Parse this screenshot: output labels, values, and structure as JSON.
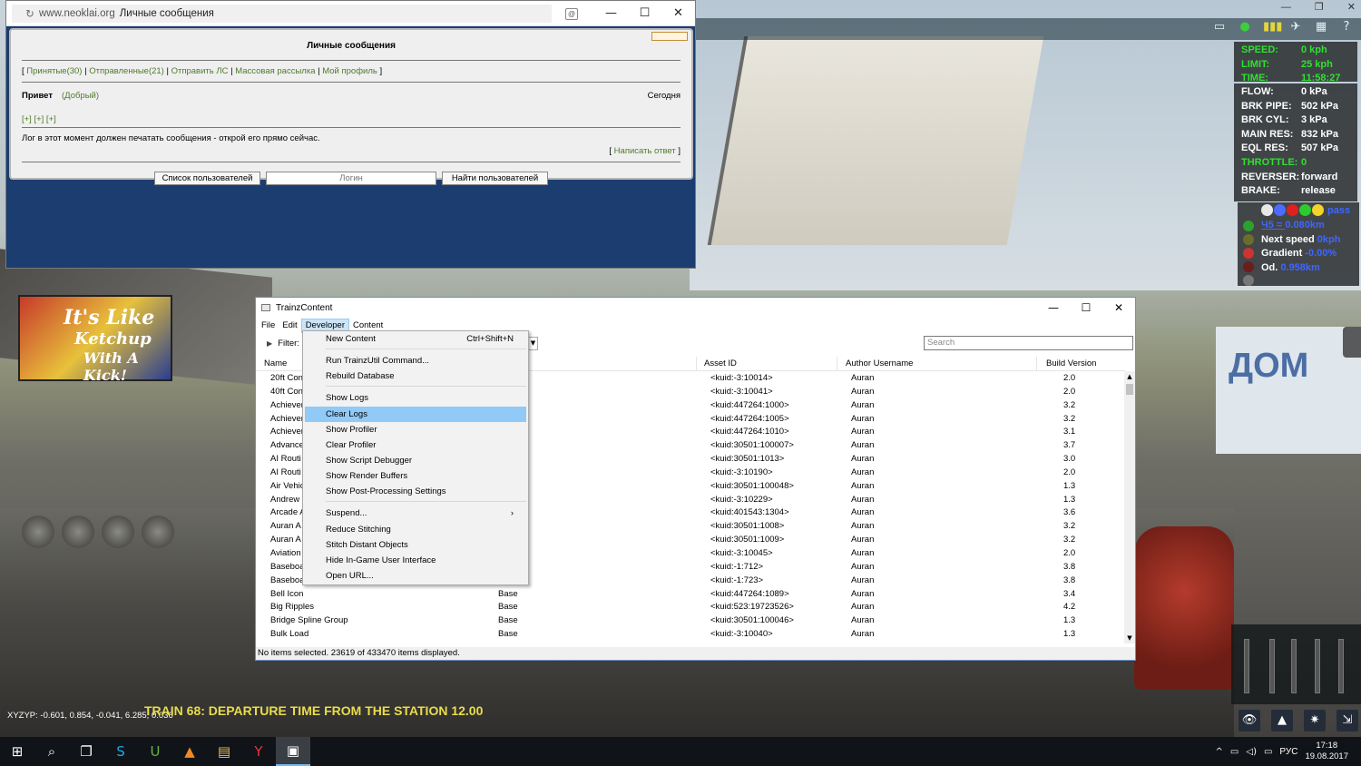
{
  "game_window": {
    "controls": [
      "—",
      "❐",
      "✕"
    ],
    "hud_icons": [
      "▭",
      "●",
      "▮▮▮",
      "✈",
      "▦",
      "?"
    ]
  },
  "hud": {
    "speed": [
      {
        "label": "SPEED:",
        "value": "0 kph"
      },
      {
        "label": "LIMIT:",
        "value": "25 kph"
      },
      {
        "label": "TIME:",
        "value": "11:58:27"
      }
    ],
    "air": [
      {
        "label": "FLOW:",
        "value": "0 kPa",
        "green": false
      },
      {
        "label": "BRK PIPE:",
        "value": "502 kPa",
        "green": false
      },
      {
        "label": "BRK CYL:",
        "value": "3 kPa",
        "green": false
      },
      {
        "label": "MAIN RES:",
        "value": "832 kPa",
        "green": false
      },
      {
        "label": "EQL RES:",
        "value": "507 kPa",
        "green": false
      },
      {
        "label": "THROTTLE:",
        "value": "0",
        "green": true
      },
      {
        "label": "REVERSER:",
        "value": "forward",
        "green": false
      },
      {
        "label": "BRAKE:",
        "value": "release",
        "green": false
      }
    ],
    "signal": {
      "pass_label": "pass",
      "lamp_colors": [
        "#e8e8e8",
        "#4b6cff",
        "#e02020",
        "#2bcc2b",
        "#f2d22b"
      ],
      "distance_label": "Ч5 = ",
      "distance_value": "0.080km",
      "next_speed_label": "Next speed ",
      "next_speed_value": "0kph",
      "gradient_label": "Gradient ",
      "gradient_value": "-0.00%",
      "od_label": "Od. ",
      "od_value": "0.958km"
    },
    "bottom_buttons": [
      "👁",
      "▲",
      "✷",
      "⇲"
    ]
  },
  "overlay": {
    "coords": "XYZYP: -0.601, 0.854, -0.041, 6.285, 0.036",
    "train_message": "TRAIN 68: DEPARTURE TIME FROM THE STATION 12.00"
  },
  "browser": {
    "address_domain": "www.neoklai.org",
    "address_title": "Личные сообщения",
    "controls": [
      "—",
      "☐",
      "✕"
    ],
    "pm_title": "Личные сообщения",
    "nav": [
      {
        "label": "Принятые",
        "count": "(30)"
      },
      {
        "label": "Отправленные",
        "count": "(21)"
      },
      {
        "label": "Отправить ЛС",
        "count": ""
      },
      {
        "label": "Массовая рассылка",
        "count": ""
      },
      {
        "label": "Мой профиль",
        "count": ""
      }
    ],
    "message_subject": "Привет",
    "message_from": "(Добрый)",
    "message_date": "Сегодня",
    "plus_links": "[+] [+] [+]",
    "message_body": "Лог в этот момент должен печатать сообщения - открой его прямо сейчас.",
    "reply_link": "Написать ответ",
    "users_button": "Список пользователей",
    "login_placeholder": "Логин",
    "find_button": "Найти пользователей"
  },
  "trainz": {
    "title": "TrainzContent",
    "controls": [
      "—",
      "☐",
      "✕"
    ],
    "menu": [
      "File",
      "Edit",
      "Developer",
      "Content"
    ],
    "active_menu": "Developer",
    "filter_label": "Filter:",
    "search_placeholder": "Search",
    "columns": [
      "Name",
      "Asset ID",
      "Author Username",
      "Build Version"
    ],
    "rows": [
      {
        "name": "20ft Con",
        "type": "",
        "asset": "<kuid:-3:10014>",
        "author": "Auran",
        "build": "2.0"
      },
      {
        "name": "40ft Con",
        "type": "",
        "asset": "<kuid:-3:10041>",
        "author": "Auran",
        "build": "2.0"
      },
      {
        "name": "Achiever",
        "type": "",
        "asset": "<kuid:447264:1000>",
        "author": "Auran",
        "build": "3.2"
      },
      {
        "name": "Achiever",
        "type": "",
        "asset": "<kuid:447264:1005>",
        "author": "Auran",
        "build": "3.2"
      },
      {
        "name": "Achiever",
        "type": "",
        "asset": "<kuid:447264:1010>",
        "author": "Auran",
        "build": "3.1"
      },
      {
        "name": "Advance",
        "type": "",
        "asset": "<kuid:30501:100007>",
        "author": "Auran",
        "build": "3.7"
      },
      {
        "name": "AI Routi",
        "type": "",
        "asset": "<kuid:30501:1013>",
        "author": "Auran",
        "build": "3.0"
      },
      {
        "name": "AI Routi",
        "type": "",
        "asset": "<kuid:-3:10190>",
        "author": "Auran",
        "build": "2.0"
      },
      {
        "name": "Air Vehic",
        "type": "",
        "asset": "<kuid:30501:100048>",
        "author": "Auran",
        "build": "1.3"
      },
      {
        "name": "Andrew",
        "type": "",
        "asset": "<kuid:-3:10229>",
        "author": "Auran",
        "build": "1.3"
      },
      {
        "name": "Arcade A",
        "type": "",
        "asset": "<kuid:401543:1304>",
        "author": "Auran",
        "build": "3.6"
      },
      {
        "name": "Auran A",
        "type": "",
        "asset": "<kuid:30501:1008>",
        "author": "Auran",
        "build": "3.2"
      },
      {
        "name": "Auran A",
        "type": "",
        "asset": "<kuid:30501:1009>",
        "author": "Auran",
        "build": "3.2"
      },
      {
        "name": "Aviation",
        "type": "",
        "asset": "<kuid:-3:10045>",
        "author": "Auran",
        "build": "2.0"
      },
      {
        "name": "Baseboa",
        "type": "",
        "asset": "<kuid:-1:712>",
        "author": "Auran",
        "build": "3.8"
      },
      {
        "name": "Baseboa",
        "type": "",
        "asset": "<kuid:-1:723>",
        "author": "Auran",
        "build": "3.8"
      },
      {
        "name": "Bell Icon",
        "type": "Base",
        "asset": "<kuid:447264:1089>",
        "author": "Auran",
        "build": "3.4"
      },
      {
        "name": "Big Ripples",
        "type": "Base",
        "asset": "<kuid:523:19723526>",
        "author": "Auran",
        "build": "4.2"
      },
      {
        "name": "Bridge Spline Group",
        "type": "Base",
        "asset": "<kuid:30501:100046>",
        "author": "Auran",
        "build": "1.3"
      },
      {
        "name": "Bulk Load",
        "type": "Base",
        "asset": "<kuid:-3:10040>",
        "author": "Auran",
        "build": "1.3"
      }
    ],
    "status": "No items selected. 23619 of 433470 items displayed.",
    "developer_menu": [
      {
        "label": "New Content",
        "shortcut": "Ctrl+Shift+N",
        "sep_after": true
      },
      {
        "label": "Run TrainzUtil Command...",
        "shortcut": "",
        "sep_after": false
      },
      {
        "label": "Rebuild Database",
        "shortcut": "",
        "sep_after": true
      },
      {
        "label": "Show Logs",
        "shortcut": "",
        "sep_after": false
      },
      {
        "label": "Clear Logs",
        "shortcut": "",
        "sep_after": false,
        "highlighted": true
      },
      {
        "label": "Show Profiler",
        "shortcut": "",
        "sep_after": false
      },
      {
        "label": "Clear Profiler",
        "shortcut": "",
        "sep_after": false
      },
      {
        "label": "Show Script Debugger",
        "shortcut": "",
        "sep_after": false
      },
      {
        "label": "Show Render Buffers",
        "shortcut": "",
        "sep_after": false
      },
      {
        "label": "Show Post-Processing Settings",
        "shortcut": "",
        "sep_after": true
      },
      {
        "label": "Suspend...",
        "shortcut": "›",
        "sep_after": false
      },
      {
        "label": "Reduce Stitching",
        "shortcut": "",
        "sep_after": false
      },
      {
        "label": "Stitch Distant Objects",
        "shortcut": "",
        "sep_after": false
      },
      {
        "label": "Hide In-Game User Interface",
        "shortcut": "",
        "sep_after": false
      },
      {
        "label": "Open URL...",
        "shortcut": "",
        "sep_after": false
      }
    ]
  },
  "taskbar": {
    "apps": [
      {
        "icon": "⊞",
        "name": "start-button"
      },
      {
        "icon": "⌕",
        "name": "search-icon"
      },
      {
        "icon": "❐",
        "name": "task-view-icon"
      },
      {
        "icon": "S",
        "name": "skype-icon"
      },
      {
        "icon": "U",
        "name": "utorrent-icon"
      },
      {
        "icon": "▲",
        "name": "avast-icon"
      },
      {
        "icon": "▤",
        "name": "explorer-icon"
      },
      {
        "icon": "Y",
        "name": "yandex-browser-icon"
      },
      {
        "icon": "▣",
        "name": "trainz-icon"
      }
    ],
    "tray_icons": [
      "^",
      "▭",
      "◁)",
      "▭"
    ],
    "language": "РУС",
    "time": "17:18",
    "date": "19.08.2017"
  }
}
